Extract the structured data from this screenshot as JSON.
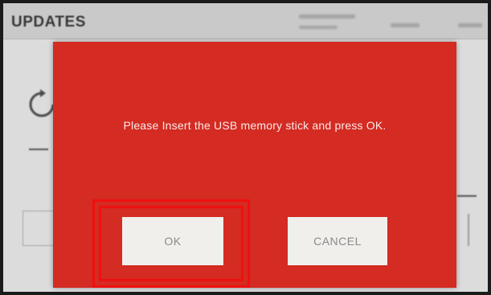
{
  "header": {
    "title": "UPDATES"
  },
  "dialog": {
    "message": "Please Insert the USB memory stick and press OK.",
    "ok_label": "OK",
    "cancel_label": "CANCEL"
  },
  "colors": {
    "dialog_background": "#d42b22",
    "button_background": "#f1efec",
    "highlight": "#ee1010"
  },
  "icons": {
    "background_refresh": "refresh-icon"
  }
}
